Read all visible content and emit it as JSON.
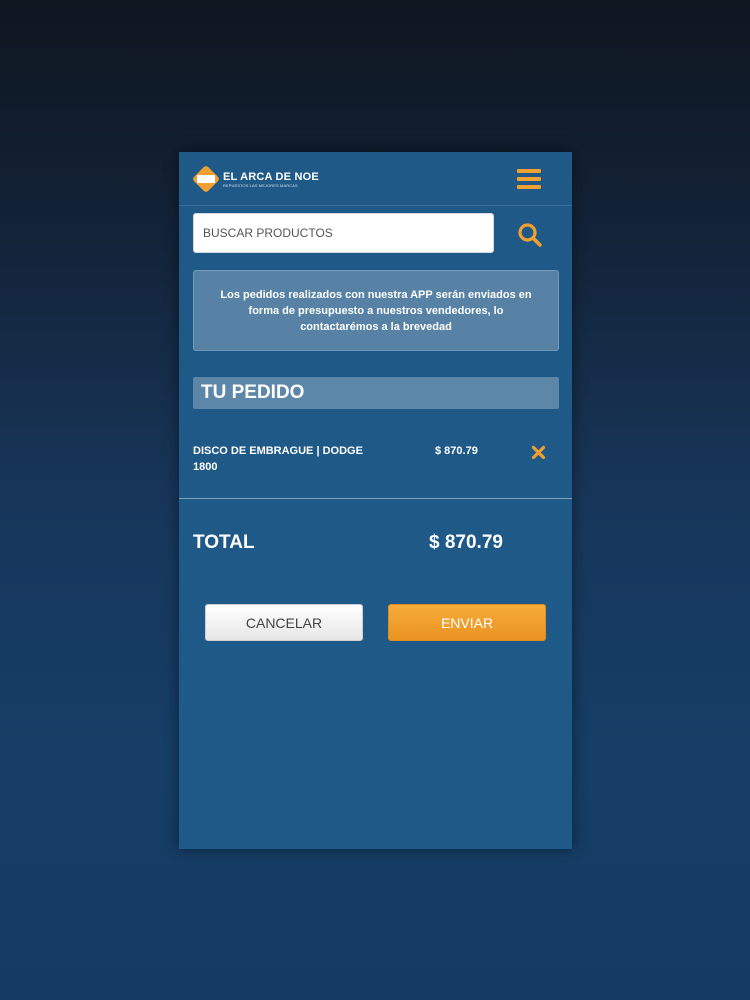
{
  "header": {
    "brand_name": "EL ARCA DE NOE",
    "brand_tagline": "REPUESTOS LAS MEJORES MARCAS",
    "menu_icon": "hamburger-menu-icon"
  },
  "search": {
    "placeholder": "BUSCAR PRODUCTOS",
    "icon": "search-icon"
  },
  "notice": {
    "text": "Los pedidos realizados con nuestra APP serán enviados en forma de presupuesto a nuestros vendedores, lo contactarémos a la brevedad"
  },
  "order": {
    "title": "TU PEDIDO",
    "items": [
      {
        "name": "DISCO DE EMBRAGUE | DODGE 1800",
        "price": "$ 870.79"
      }
    ],
    "total_label": "TOTAL",
    "total_value": "$ 870.79"
  },
  "actions": {
    "cancel_label": "CANCELAR",
    "send_label": "ENVIAR"
  },
  "colors": {
    "accent": "#f0a030",
    "panel": "#1f5987"
  }
}
